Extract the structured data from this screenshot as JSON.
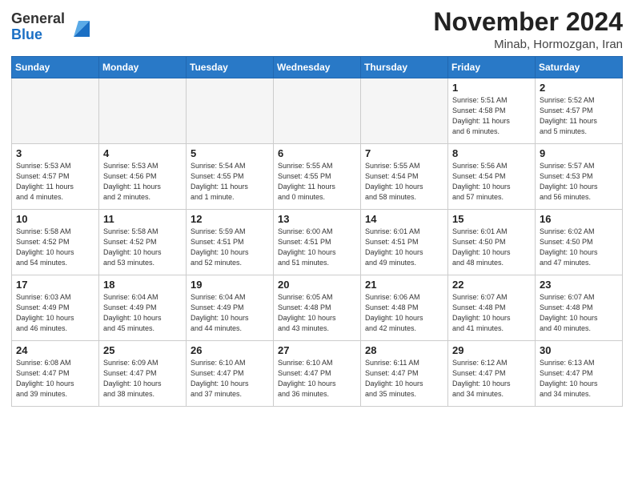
{
  "header": {
    "logo_general": "General",
    "logo_blue": "Blue",
    "month_title": "November 2024",
    "subtitle": "Minab, Hormozgan, Iran"
  },
  "weekdays": [
    "Sunday",
    "Monday",
    "Tuesday",
    "Wednesday",
    "Thursday",
    "Friday",
    "Saturday"
  ],
  "weeks": [
    [
      {
        "day": "",
        "info": ""
      },
      {
        "day": "",
        "info": ""
      },
      {
        "day": "",
        "info": ""
      },
      {
        "day": "",
        "info": ""
      },
      {
        "day": "",
        "info": ""
      },
      {
        "day": "1",
        "info": "Sunrise: 5:51 AM\nSunset: 4:58 PM\nDaylight: 11 hours\nand 6 minutes."
      },
      {
        "day": "2",
        "info": "Sunrise: 5:52 AM\nSunset: 4:57 PM\nDaylight: 11 hours\nand 5 minutes."
      }
    ],
    [
      {
        "day": "3",
        "info": "Sunrise: 5:53 AM\nSunset: 4:57 PM\nDaylight: 11 hours\nand 4 minutes."
      },
      {
        "day": "4",
        "info": "Sunrise: 5:53 AM\nSunset: 4:56 PM\nDaylight: 11 hours\nand 2 minutes."
      },
      {
        "day": "5",
        "info": "Sunrise: 5:54 AM\nSunset: 4:55 PM\nDaylight: 11 hours\nand 1 minute."
      },
      {
        "day": "6",
        "info": "Sunrise: 5:55 AM\nSunset: 4:55 PM\nDaylight: 11 hours\nand 0 minutes."
      },
      {
        "day": "7",
        "info": "Sunrise: 5:55 AM\nSunset: 4:54 PM\nDaylight: 10 hours\nand 58 minutes."
      },
      {
        "day": "8",
        "info": "Sunrise: 5:56 AM\nSunset: 4:54 PM\nDaylight: 10 hours\nand 57 minutes."
      },
      {
        "day": "9",
        "info": "Sunrise: 5:57 AM\nSunset: 4:53 PM\nDaylight: 10 hours\nand 56 minutes."
      }
    ],
    [
      {
        "day": "10",
        "info": "Sunrise: 5:58 AM\nSunset: 4:52 PM\nDaylight: 10 hours\nand 54 minutes."
      },
      {
        "day": "11",
        "info": "Sunrise: 5:58 AM\nSunset: 4:52 PM\nDaylight: 10 hours\nand 53 minutes."
      },
      {
        "day": "12",
        "info": "Sunrise: 5:59 AM\nSunset: 4:51 PM\nDaylight: 10 hours\nand 52 minutes."
      },
      {
        "day": "13",
        "info": "Sunrise: 6:00 AM\nSunset: 4:51 PM\nDaylight: 10 hours\nand 51 minutes."
      },
      {
        "day": "14",
        "info": "Sunrise: 6:01 AM\nSunset: 4:51 PM\nDaylight: 10 hours\nand 49 minutes."
      },
      {
        "day": "15",
        "info": "Sunrise: 6:01 AM\nSunset: 4:50 PM\nDaylight: 10 hours\nand 48 minutes."
      },
      {
        "day": "16",
        "info": "Sunrise: 6:02 AM\nSunset: 4:50 PM\nDaylight: 10 hours\nand 47 minutes."
      }
    ],
    [
      {
        "day": "17",
        "info": "Sunrise: 6:03 AM\nSunset: 4:49 PM\nDaylight: 10 hours\nand 46 minutes."
      },
      {
        "day": "18",
        "info": "Sunrise: 6:04 AM\nSunset: 4:49 PM\nDaylight: 10 hours\nand 45 minutes."
      },
      {
        "day": "19",
        "info": "Sunrise: 6:04 AM\nSunset: 4:49 PM\nDaylight: 10 hours\nand 44 minutes."
      },
      {
        "day": "20",
        "info": "Sunrise: 6:05 AM\nSunset: 4:48 PM\nDaylight: 10 hours\nand 43 minutes."
      },
      {
        "day": "21",
        "info": "Sunrise: 6:06 AM\nSunset: 4:48 PM\nDaylight: 10 hours\nand 42 minutes."
      },
      {
        "day": "22",
        "info": "Sunrise: 6:07 AM\nSunset: 4:48 PM\nDaylight: 10 hours\nand 41 minutes."
      },
      {
        "day": "23",
        "info": "Sunrise: 6:07 AM\nSunset: 4:48 PM\nDaylight: 10 hours\nand 40 minutes."
      }
    ],
    [
      {
        "day": "24",
        "info": "Sunrise: 6:08 AM\nSunset: 4:47 PM\nDaylight: 10 hours\nand 39 minutes."
      },
      {
        "day": "25",
        "info": "Sunrise: 6:09 AM\nSunset: 4:47 PM\nDaylight: 10 hours\nand 38 minutes."
      },
      {
        "day": "26",
        "info": "Sunrise: 6:10 AM\nSunset: 4:47 PM\nDaylight: 10 hours\nand 37 minutes."
      },
      {
        "day": "27",
        "info": "Sunrise: 6:10 AM\nSunset: 4:47 PM\nDaylight: 10 hours\nand 36 minutes."
      },
      {
        "day": "28",
        "info": "Sunrise: 6:11 AM\nSunset: 4:47 PM\nDaylight: 10 hours\nand 35 minutes."
      },
      {
        "day": "29",
        "info": "Sunrise: 6:12 AM\nSunset: 4:47 PM\nDaylight: 10 hours\nand 34 minutes."
      },
      {
        "day": "30",
        "info": "Sunrise: 6:13 AM\nSunset: 4:47 PM\nDaylight: 10 hours\nand 34 minutes."
      }
    ]
  ]
}
